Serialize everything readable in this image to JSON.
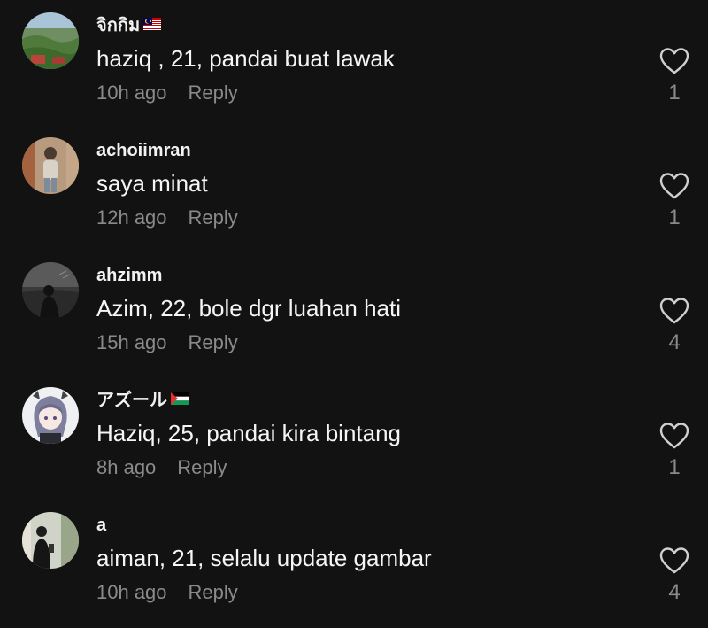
{
  "comments": [
    {
      "username": "จิกกิม",
      "flag": "malaysia-flag-icon",
      "text": "haziq , 21, pandai buat lawak",
      "time": "10h ago",
      "reply_label": "Reply",
      "likes": "1"
    },
    {
      "username": "achoiimran",
      "flag": "",
      "text": "saya minat",
      "time": "12h ago",
      "reply_label": "Reply",
      "likes": "1"
    },
    {
      "username": "ahzimm",
      "flag": "",
      "text": "Azim, 22, bole dgr luahan hati",
      "time": "15h ago",
      "reply_label": "Reply",
      "likes": "4"
    },
    {
      "username": "アズール",
      "flag": "palestine-flag-icon",
      "text": "Haziq, 25, pandai kira bintang",
      "time": "8h ago",
      "reply_label": "Reply",
      "likes": "1"
    },
    {
      "username": "a",
      "flag": "",
      "text": "aiman, 21, selalu update gambar",
      "time": "10h ago",
      "reply_label": "Reply",
      "likes": "4"
    }
  ],
  "colors": {
    "background": "#121212",
    "primary_text": "#f5f5f5",
    "secondary_text": "#8a8a8a"
  }
}
